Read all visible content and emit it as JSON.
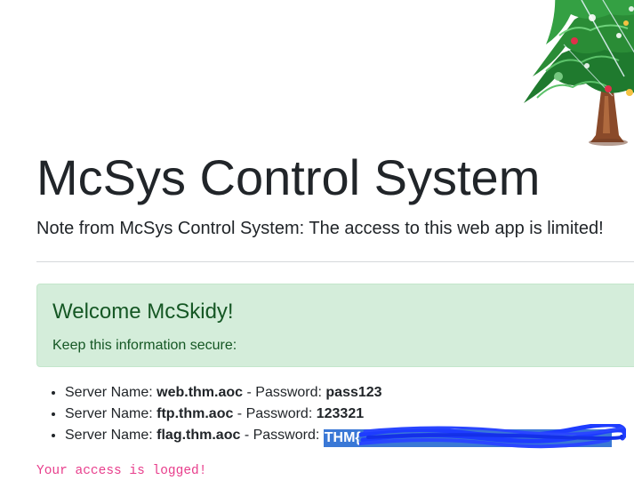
{
  "header": {
    "title": "McSys Control System",
    "lead": "Note from McSys Control System: The access to this web app is limited!"
  },
  "alert": {
    "heading": "Welcome McSkidy!",
    "text": "Keep this information secure:"
  },
  "servers": [
    {
      "name_label": "Server Name: ",
      "name": "web.thm.aoc",
      "password_label": " - Password: ",
      "password": "pass123"
    },
    {
      "name_label": "Server Name: ",
      "name": "ftp.thm.aoc",
      "password_label": " - Password: ",
      "password": "123321"
    },
    {
      "name_label": "Server Name: ",
      "name": "flag.thm.aoc",
      "password_label": " - Password: ",
      "password": "THM{"
    }
  ],
  "footer": {
    "logged_text": "Your access is logged!"
  },
  "decor": {
    "tree_icon": "christmas-tree-icon",
    "redaction": "blue-scribble-redaction"
  },
  "colors": {
    "alert_bg": "#d4edda",
    "alert_text": "#155724",
    "selection": "#3a78d6",
    "logged_text": "#e83e8c"
  }
}
